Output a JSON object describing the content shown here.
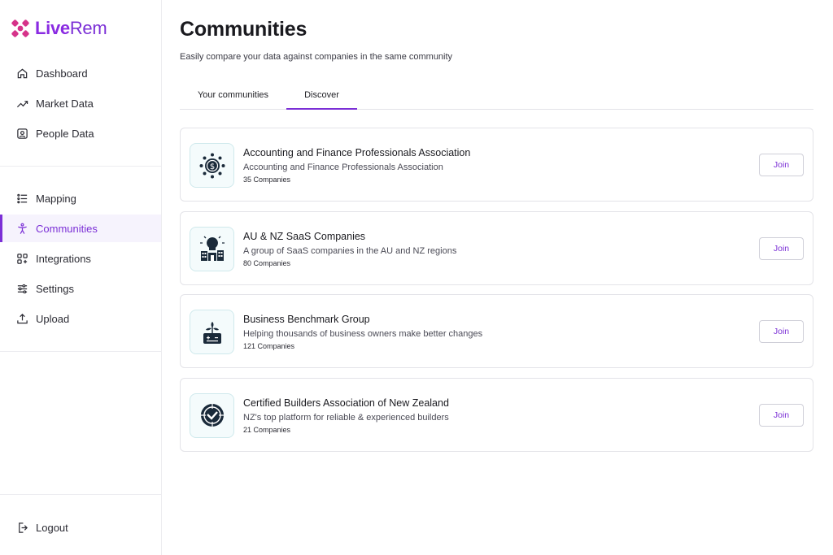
{
  "brand": {
    "name_part1": "Live",
    "name_part2": "Rem",
    "accent": "#7b2fd6",
    "logo_color": "#d6338a"
  },
  "sidebar": {
    "primary": [
      {
        "label": "Dashboard",
        "icon": "home-icon"
      },
      {
        "label": "Market Data",
        "icon": "chart-line-icon"
      },
      {
        "label": "People Data",
        "icon": "id-badge-icon"
      }
    ],
    "secondary": [
      {
        "label": "Mapping",
        "icon": "list-icon"
      },
      {
        "label": "Communities",
        "icon": "person-icon",
        "active": true
      },
      {
        "label": "Integrations",
        "icon": "grid-plus-icon"
      },
      {
        "label": "Settings",
        "icon": "sliders-icon"
      },
      {
        "label": "Upload",
        "icon": "upload-icon"
      }
    ],
    "logout": {
      "label": "Logout",
      "icon": "logout-icon"
    }
  },
  "page": {
    "title": "Communities",
    "subtitle": "Easily compare your data against companies in the same community"
  },
  "tabs": [
    {
      "label": "Your communities",
      "active": false
    },
    {
      "label": "Discover",
      "active": true
    }
  ],
  "communities": [
    {
      "name": "Accounting and Finance Professionals Association",
      "description": "Accounting and Finance Professionals Association",
      "count": "35 Companies",
      "icon": "finance-gear-icon",
      "join": "Join"
    },
    {
      "name": "AU & NZ SaaS Companies",
      "description": "A group of SaaS companies in the AU and NZ regions",
      "count": "80 Companies",
      "icon": "lightbulb-city-icon",
      "join": "Join"
    },
    {
      "name": "Business Benchmark Group",
      "description": "Helping thousands of business owners make better changes",
      "count": "121 Companies",
      "icon": "plant-calculator-icon",
      "join": "Join"
    },
    {
      "name": "Certified Builders Association of New Zealand",
      "description": "NZ's top platform for reliable & experienced builders",
      "count": "21 Companies",
      "icon": "badge-check-icon",
      "join": "Join"
    }
  ]
}
